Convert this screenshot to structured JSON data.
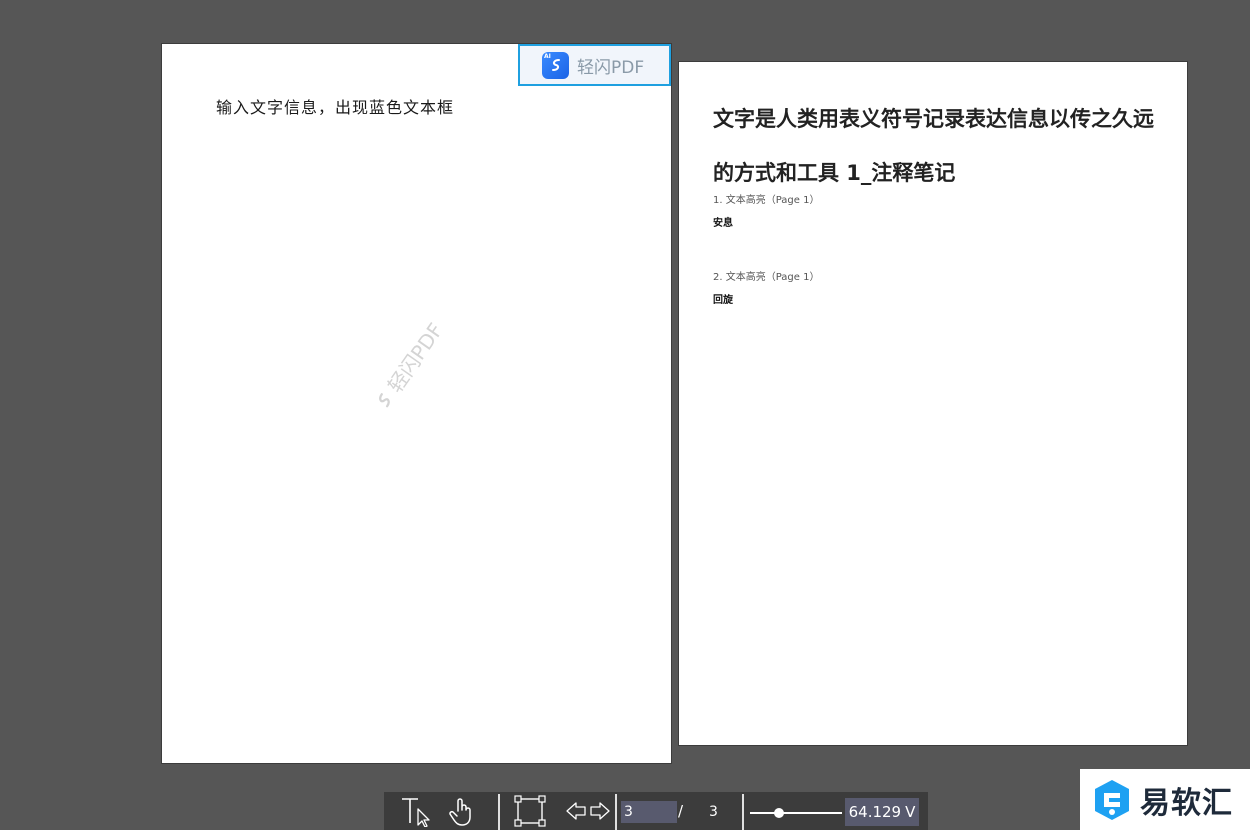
{
  "left_page": {
    "body_text": "输入文字信息，出现蓝色文本框",
    "brand_badge": {
      "ai_tag": "AI",
      "name": "轻闪PDF"
    },
    "watermark": "轻闪PDF"
  },
  "right_page": {
    "title": "文字是人类用表义符号记录表达信息以传之久远的方式和工具 1_注释笔记",
    "notes": [
      {
        "heading": "1. 文本高亮（Page 1）",
        "content": "安息"
      },
      {
        "heading": "2. 文本高亮（Page 1）",
        "content": "回旋"
      }
    ]
  },
  "toolbar": {
    "current_page": "3",
    "page_separator": "/",
    "total_pages": "3",
    "zoom_value": "64.129",
    "zoom_dropdown": "V",
    "icons": [
      "text-select-icon",
      "hand-icon",
      "fit-page-icon",
      "prev-page-icon",
      "next-page-icon"
    ]
  },
  "site_logo": {
    "name": "易软汇"
  },
  "colors": {
    "background": "#565656",
    "toolbar": "#3c3c3c",
    "badge_border": "#1fa0e0",
    "logo_blue": "#1b63e6"
  }
}
